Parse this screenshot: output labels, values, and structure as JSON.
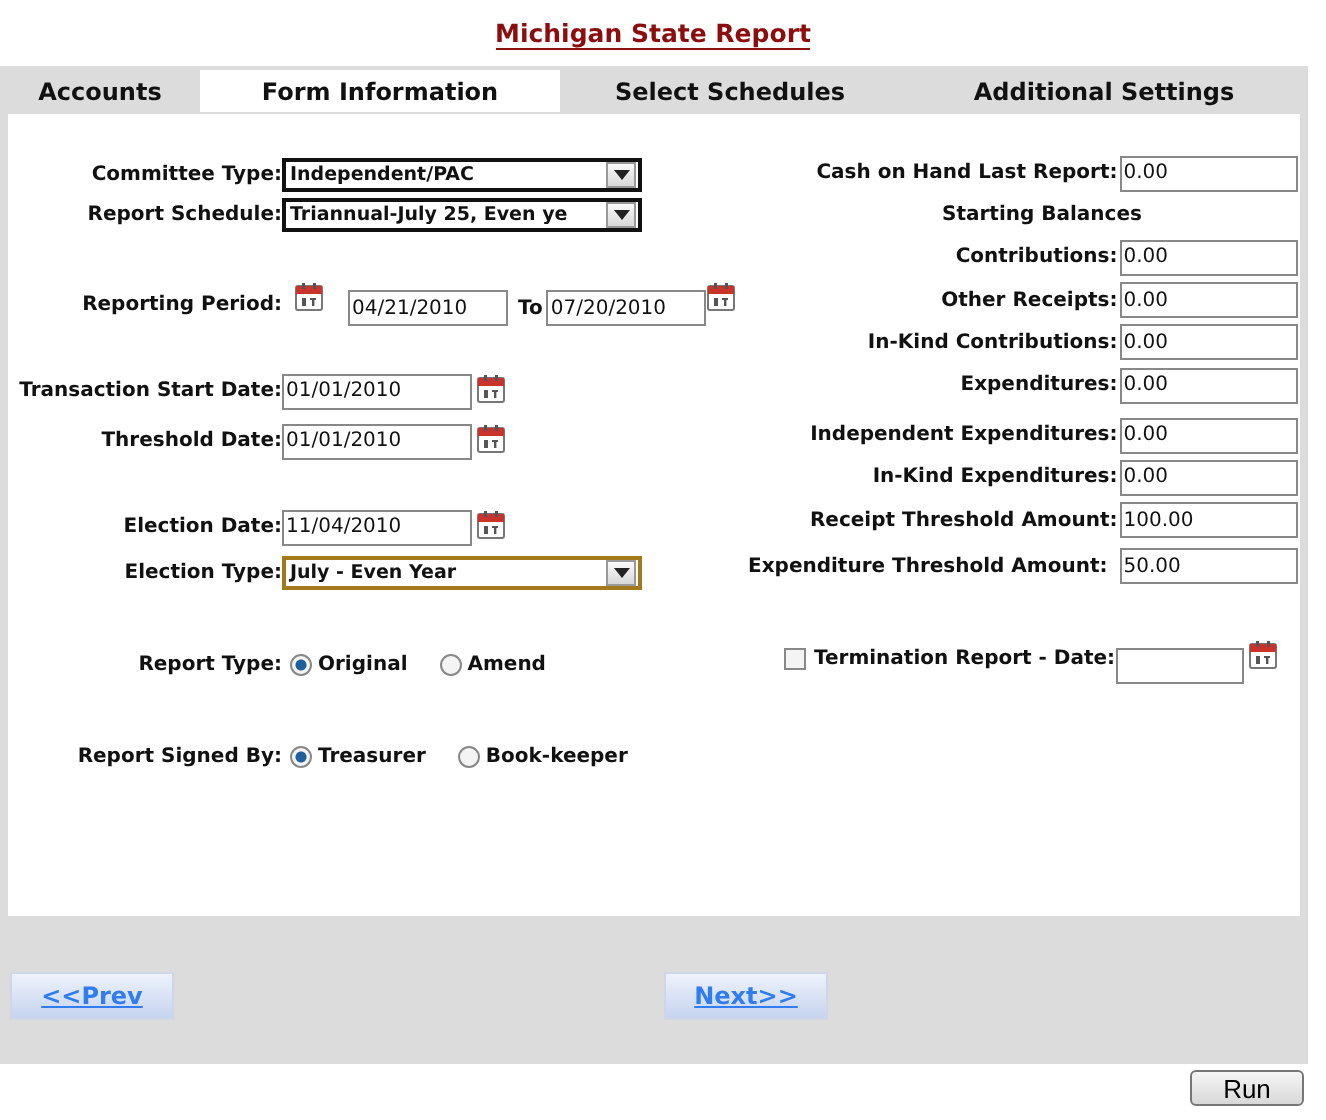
{
  "title": "Michigan State Report",
  "tabs": [
    {
      "label": "Accounts",
      "selected": false
    },
    {
      "label": "Form Information",
      "selected": true
    },
    {
      "label": "Select Schedules",
      "selected": false
    },
    {
      "label": "Additional Settings",
      "selected": false
    }
  ],
  "left_fields": [
    {
      "kind": "select",
      "label": "Committee Type:",
      "value": "Independent/PAC",
      "focused": false
    },
    {
      "kind": "select",
      "label": "Report Schedule:",
      "value": "Triannual-July 25, Even ye",
      "focused": false
    },
    {
      "kind": "period",
      "label": "Reporting Period:",
      "from": "04/21/2010",
      "joiner": "To",
      "to": "07/20/2010"
    },
    {
      "kind": "date",
      "label": "Transaction Start Date:",
      "value": "01/01/2010"
    },
    {
      "kind": "date",
      "label": "Threshold Date:",
      "value": "01/01/2010"
    },
    {
      "kind": "date",
      "label": "Election Date:",
      "value": "11/04/2010"
    },
    {
      "kind": "select",
      "label": "Election Type:",
      "value": "July - Even Year",
      "focused": true
    }
  ],
  "radio_groups": [
    {
      "label": "Report Type:",
      "options": [
        {
          "label": "Original",
          "selected": true
        },
        {
          "label": "Amend",
          "selected": false
        }
      ]
    },
    {
      "label": "Report Signed By:",
      "options": [
        {
          "label": "Treasurer",
          "selected": true
        },
        {
          "label": "Book-keeper",
          "selected": false
        }
      ]
    }
  ],
  "right_fields": [
    {
      "kind": "amount",
      "label": "Cash on Hand Last Report:",
      "value": "0.00"
    },
    {
      "kind": "heading",
      "label": "Starting Balances"
    },
    {
      "kind": "amount",
      "label": "Contributions:",
      "value": "0.00"
    },
    {
      "kind": "amount",
      "label": "Other Receipts:",
      "value": "0.00"
    },
    {
      "kind": "amount",
      "label": "In-Kind Contributions:",
      "value": "0.00"
    },
    {
      "kind": "amount",
      "label": "Expenditures:",
      "value": "0.00"
    },
    {
      "kind": "amount",
      "label": "Independent Expenditures:",
      "value": "0.00"
    },
    {
      "kind": "amount",
      "label": "In-Kind Expenditures:",
      "value": "0.00"
    },
    {
      "kind": "amount",
      "label": "Receipt Threshold Amount:",
      "value": "100.00"
    },
    {
      "kind": "amount",
      "label": "Expenditure Threshold Amount:",
      "value": "50.00"
    }
  ],
  "termination": {
    "label": "Termination Report - Date:",
    "checked": false
  },
  "nav": {
    "prev": "<<Prev",
    "next": "Next>>"
  },
  "run": "Run"
}
